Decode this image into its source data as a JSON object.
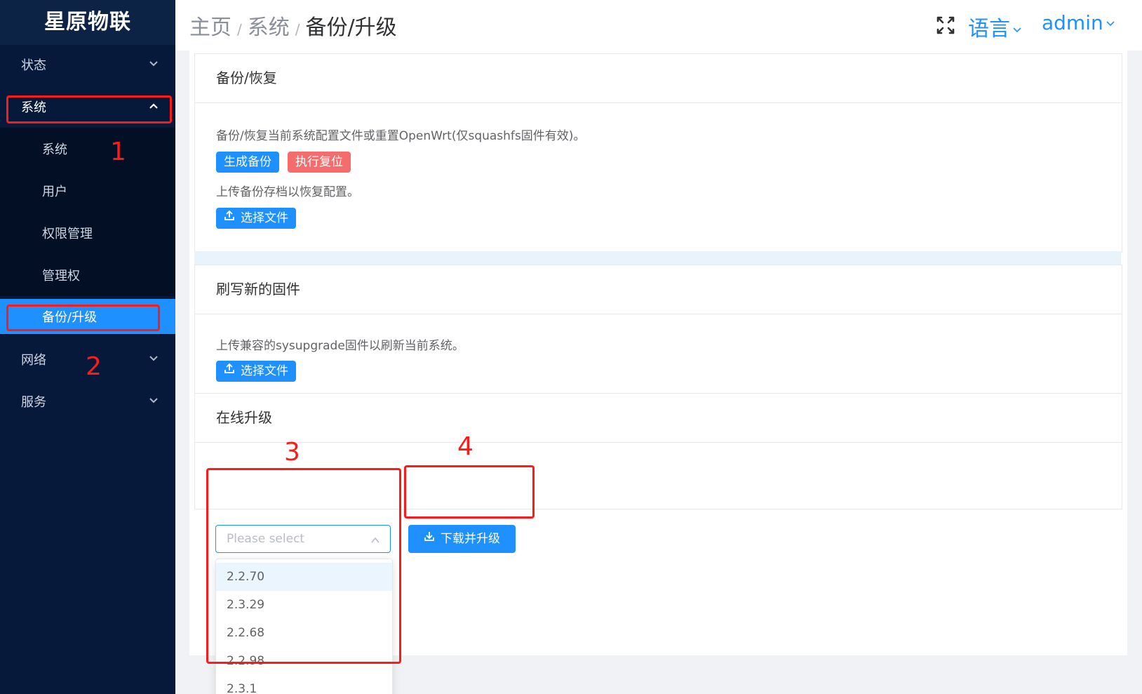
{
  "sidebar": {
    "logo": "星原物联",
    "items": [
      {
        "label": "状态"
      },
      {
        "label": "系统"
      },
      {
        "label": "系统"
      },
      {
        "label": "用户"
      },
      {
        "label": "权限管理"
      },
      {
        "label": "管理权"
      },
      {
        "label": "备份/升级"
      },
      {
        "label": "网络"
      },
      {
        "label": "服务"
      }
    ]
  },
  "header": {
    "breadcrumb": [
      "主页",
      "系统",
      "备份/升级"
    ],
    "separator": "/",
    "language": "语言",
    "user": "admin"
  },
  "backup": {
    "title": "备份/恢复",
    "description": "备份/恢复当前系统配置文件或重置OpenWrt(仅squashfs固件有效)。",
    "generate_button": "生成备份",
    "reset_button": "执行复位",
    "upload_description": "上传备份存档以恢复配置。",
    "choose_file_button": "选择文件"
  },
  "flash": {
    "title": "刷写新的固件",
    "description": "上传兼容的sysupgrade固件以刷新当前系统。",
    "choose_file_button": "选择文件"
  },
  "online": {
    "title": "在线升级",
    "select_placeholder": "Please select",
    "options": [
      "2.2.70",
      "2.3.29",
      "2.2.68",
      "2.2.98",
      "2.3.1"
    ],
    "download_button": "下载并升级"
  },
  "annotations": [
    "1",
    "2",
    "3",
    "4"
  ],
  "colors": {
    "sidebar_bg": "#07193a",
    "accent": "#1e90ff",
    "danger": "#f56c6c",
    "annotation": "#ff1a1a"
  }
}
